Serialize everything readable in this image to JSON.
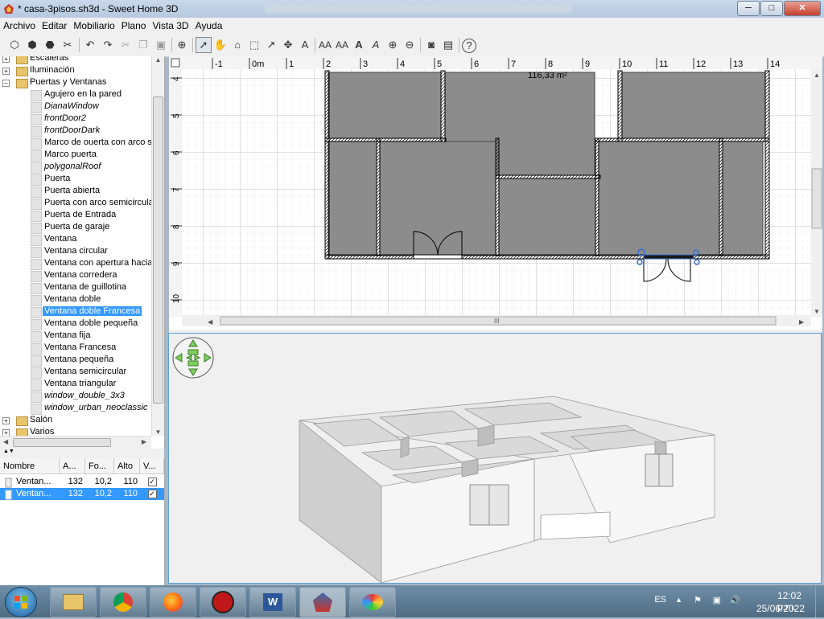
{
  "window": {
    "title": "* casa-3pisos.sh3d - Sweet Home 3D",
    "min": "─",
    "max": "□",
    "close": "✕"
  },
  "menu": [
    "Archivo",
    "Editar",
    "Mobiliario",
    "Plano",
    "Vista 3D",
    "Ayuda"
  ],
  "catalog": {
    "items": [
      {
        "label": "Escaleras",
        "type": "folder",
        "level": 0
      },
      {
        "label": "Iluminación",
        "type": "folder",
        "level": 0
      },
      {
        "label": "Puertas y Ventanas",
        "type": "folder",
        "level": 0,
        "open": true
      },
      {
        "label": "Agujero en la pared",
        "type": "item",
        "level": 1
      },
      {
        "label": "DianaWindow",
        "type": "item",
        "level": 1,
        "italic": true
      },
      {
        "label": "frontDoor2",
        "type": "item",
        "level": 1,
        "italic": true
      },
      {
        "label": "frontDoorDark",
        "type": "item",
        "level": 1,
        "italic": true
      },
      {
        "label": "Marco de ouerta con arco s",
        "type": "item",
        "level": 1
      },
      {
        "label": "Marco puerta",
        "type": "item",
        "level": 1
      },
      {
        "label": "polygonalRoof",
        "type": "item",
        "level": 1,
        "italic": true
      },
      {
        "label": "Puerta",
        "type": "item",
        "level": 1
      },
      {
        "label": "Puerta abierta",
        "type": "item",
        "level": 1
      },
      {
        "label": "Puerta con arco semicircula",
        "type": "item",
        "level": 1
      },
      {
        "label": "Puerta de Entrada",
        "type": "item",
        "level": 1
      },
      {
        "label": "Puerta de garaje",
        "type": "item",
        "level": 1
      },
      {
        "label": "Ventana",
        "type": "item",
        "level": 1
      },
      {
        "label": "Ventana circular",
        "type": "item",
        "level": 1
      },
      {
        "label": "Ventana con apertura hacia",
        "type": "item",
        "level": 1
      },
      {
        "label": "Ventana corredera",
        "type": "item",
        "level": 1
      },
      {
        "label": "Ventana de guillotina",
        "type": "item",
        "level": 1
      },
      {
        "label": "Ventana doble",
        "type": "item",
        "level": 1
      },
      {
        "label": "Ventana doble Francesa",
        "type": "item",
        "level": 1,
        "selected": true
      },
      {
        "label": "Ventana doble pequeña",
        "type": "item",
        "level": 1
      },
      {
        "label": "Ventana fija",
        "type": "item",
        "level": 1
      },
      {
        "label": "Ventana Francesa",
        "type": "item",
        "level": 1
      },
      {
        "label": "Ventana pequeña",
        "type": "item",
        "level": 1
      },
      {
        "label": "Ventana semicircular",
        "type": "item",
        "level": 1
      },
      {
        "label": "Ventana triangular",
        "type": "item",
        "level": 1
      },
      {
        "label": "window_double_3x3",
        "type": "item",
        "level": 1,
        "italic": true
      },
      {
        "label": "window_urban_neoclassic",
        "type": "item",
        "level": 1,
        "italic": true
      },
      {
        "label": "Salón",
        "type": "folder",
        "level": 0
      },
      {
        "label": "Varios",
        "type": "folder",
        "level": 0
      }
    ]
  },
  "furniture": {
    "columns": [
      "Nombre",
      "A...",
      "Fo...",
      "Alto",
      "V..."
    ],
    "rows": [
      {
        "name": "Ventan...",
        "width": "132",
        "depth": "10,2",
        "height": "110",
        "visible": "✓"
      },
      {
        "name": "Ventan...",
        "width": "132",
        "depth": "10,2",
        "height": "110",
        "visible": "✓"
      }
    ]
  },
  "plan": {
    "ruler_x": [
      "-1",
      "0m",
      "1",
      "2",
      "3",
      "4",
      "5",
      "6",
      "7",
      "8",
      "9",
      "10",
      "11",
      "12",
      "13",
      "14"
    ],
    "ruler_y": [
      "4",
      "5",
      "6",
      "7",
      "8",
      "9",
      "10"
    ],
    "area_label": "116,33 m²",
    "scroll_grip": "III"
  },
  "taskbar": {
    "language": "ES",
    "time": "12:02 p.m.",
    "date": "25/06/2022"
  },
  "colors": {
    "room_fill": "#8c8c8c",
    "selection": "#3399ff",
    "nav_green": "#7ccf5a"
  }
}
